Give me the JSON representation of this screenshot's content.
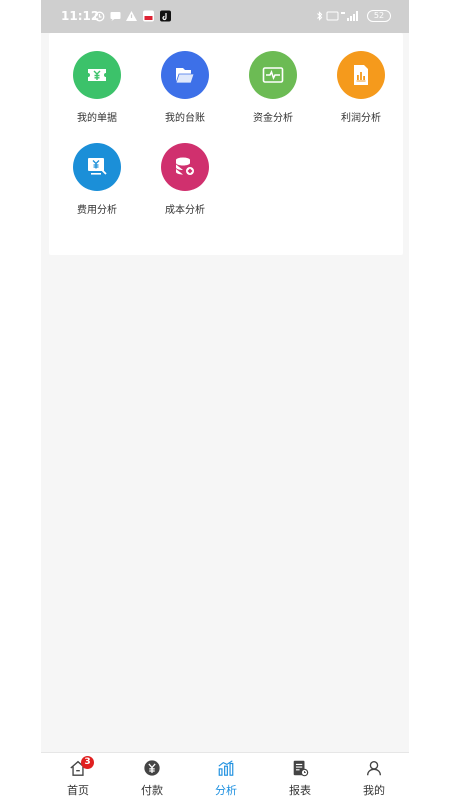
{
  "status_bar": {
    "time": "11:12",
    "battery": "52"
  },
  "colors": {
    "green": "#3cc26a",
    "blue": "#3d70e8",
    "lime": "#6cbb54",
    "orange": "#f59a1c",
    "cyan": "#1b8fd8",
    "magenta": "#d0306e",
    "tab_active": "#1e90e0"
  },
  "menu": {
    "items": [
      {
        "label": "我的单据",
        "icon": "ticket-yen-icon"
      },
      {
        "label": "我的台账",
        "icon": "folder-icon"
      },
      {
        "label": "资金分析",
        "icon": "pulse-monitor-icon"
      },
      {
        "label": "利润分析",
        "icon": "report-chart-icon"
      },
      {
        "label": "费用分析",
        "icon": "screen-yen-icon"
      },
      {
        "label": "成本分析",
        "icon": "coin-stack-icon"
      }
    ]
  },
  "tabbar": {
    "tabs": [
      {
        "label": "首页",
        "icon": "home-icon",
        "badge": "3"
      },
      {
        "label": "付款",
        "icon": "yen-coin-icon"
      },
      {
        "label": "分析",
        "icon": "bar-chart-icon",
        "active": true
      },
      {
        "label": "报表",
        "icon": "report-icon"
      },
      {
        "label": "我的",
        "icon": "user-icon"
      }
    ]
  }
}
